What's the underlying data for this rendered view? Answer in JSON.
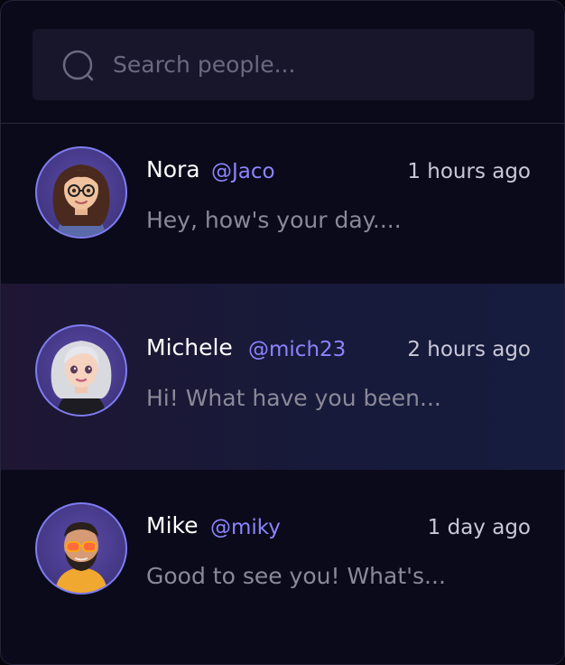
{
  "search": {
    "placeholder": "Search people...",
    "value": ""
  },
  "colors": {
    "background": "#0b0a1a",
    "search_box": "#17162a",
    "handle": "#8b84ff",
    "avatar_ring": "#7f7cf0",
    "active_row_gradient_start": "#1e1633",
    "active_row_gradient_end": "#151c3e"
  },
  "conversations": [
    {
      "name": "Nora",
      "handle": "@Jaco",
      "time": "1 hours ago",
      "preview": "Hey, how's your day....",
      "avatar_icon": "woman-glasses-avatar",
      "active": false
    },
    {
      "name": "Michele",
      "handle": "@mich23",
      "time": "2 hours ago",
      "preview": "Hi! What have you been...",
      "avatar_icon": "woman-silver-hair-avatar",
      "active": true
    },
    {
      "name": "Mike",
      "handle": "@miky",
      "time": "1 day ago",
      "preview": "Good to see you! What's...",
      "avatar_icon": "man-sunglasses-avatar",
      "active": false
    }
  ]
}
